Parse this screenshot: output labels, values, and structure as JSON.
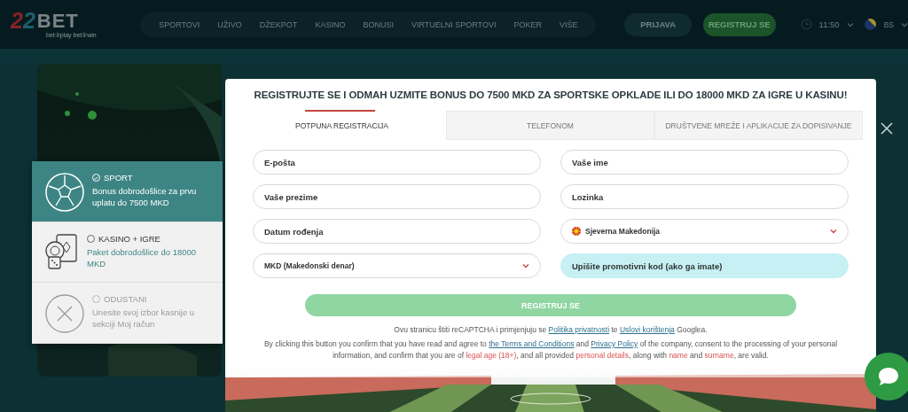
{
  "header": {
    "logo": {
      "mark": "22",
      "name": "BET",
      "tagline": "bet②play bet②win"
    },
    "nav": [
      "SPORTOVI",
      "UŽIVO",
      "DŽEKPOT",
      "KASINO",
      "BONUSI",
      "VIRTUELNI SPORTOVI",
      "POKER",
      "VIŠE"
    ],
    "login_button": "PRIJAVA",
    "register_button": "REGISTRUJ SE",
    "time": "11:50",
    "language": "BS"
  },
  "bonus_options": [
    {
      "kind": "sport",
      "title": "SPORT",
      "description": "Bonus dobrodošlice za prvu uplatu do 7500 MKD",
      "selected": true
    },
    {
      "kind": "casino",
      "title": "KASINO + IGRE",
      "description": "Paket dobrodošlice do 18000 MKD",
      "selected": false
    },
    {
      "kind": "cancel",
      "title": "ODUSTANI",
      "description": "Unesite svoj izbor kasnije u sekciji Moj račun",
      "selected": false
    }
  ],
  "modal": {
    "heading": "REGISTRUJTE SE I ODMAH UZMITE BONUS DO 7500 MKD ZA SPORTSKE OPKLADE ILI DO 18000 MKD ZA IGRE U KASINU!",
    "tabs": [
      {
        "label": "POTPUNA REGISTRACIJA",
        "selected": true
      },
      {
        "label": "TELEFONOM",
        "selected": false
      },
      {
        "label": "DRUŠTVENE MREŽE I APLIKACIJE ZA DOPISIVANJE",
        "selected": false
      }
    ],
    "fields": [
      {
        "kind": "input",
        "placeholder": "E-pošta"
      },
      {
        "kind": "input",
        "placeholder": "Vaše ime"
      },
      {
        "kind": "input",
        "placeholder": "Vaše prezime"
      },
      {
        "kind": "input",
        "placeholder": "Lozinka"
      },
      {
        "kind": "input",
        "placeholder": "Datum rođenja"
      },
      {
        "kind": "country",
        "value": "Sjeverna Makedonija"
      },
      {
        "kind": "select",
        "value": "MKD (Makedonski denar)"
      },
      {
        "kind": "promo",
        "placeholder": "Upišite promotivni kod (ako ga imate)"
      }
    ],
    "submit_button": "REGISTRUJ SE",
    "recaptcha_notice": [
      {
        "kind": "text",
        "text": "Ovu stranicu štiti reCAPTCHA i primjenjuju se "
      },
      {
        "kind": "link",
        "text": "Politika privatnosti"
      },
      {
        "kind": "text",
        "text": " te "
      },
      {
        "kind": "link",
        "text": "Uslovi korištenja"
      },
      {
        "kind": "text",
        "text": " Googlea."
      }
    ],
    "consent_notice": [
      {
        "kind": "text",
        "text": "By clicking this button you confirm that you have read and agree to "
      },
      {
        "kind": "link",
        "text": "the Terms and Conditions"
      },
      {
        "kind": "text",
        "text": " and "
      },
      {
        "kind": "link",
        "text": "Privacy Policy"
      },
      {
        "kind": "text",
        "text": " of the company, consent to the processing of your personal information, and confirm that you are of "
      },
      {
        "kind": "highlight",
        "text": "legal age (18+)"
      },
      {
        "kind": "text",
        "text": ", and all provided "
      },
      {
        "kind": "highlight",
        "text": "personal details"
      },
      {
        "kind": "text",
        "text": ", along with "
      },
      {
        "kind": "highlight",
        "text": "name"
      },
      {
        "kind": "text",
        "text": " and "
      },
      {
        "kind": "highlight",
        "text": "surname"
      },
      {
        "kind": "text",
        "text": ", are valid."
      }
    ]
  }
}
